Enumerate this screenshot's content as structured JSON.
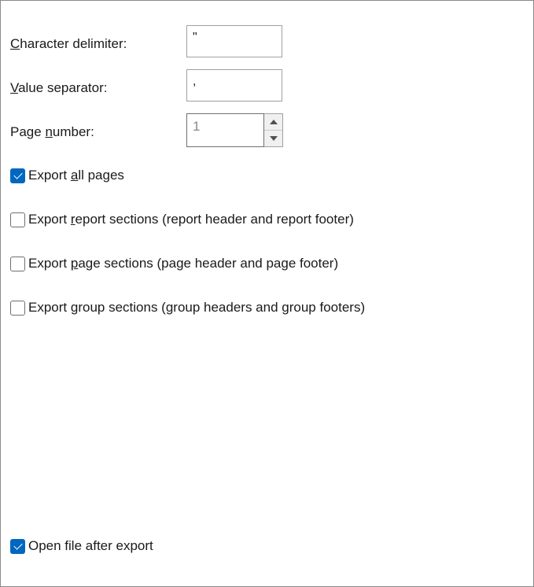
{
  "fields": {
    "character_delimiter": {
      "label_prefix": "",
      "label_key": "C",
      "label_rest": "haracter delimiter:",
      "value": "\""
    },
    "value_separator": {
      "label_prefix": "",
      "label_key": "V",
      "label_rest": "alue separator:",
      "value": ","
    },
    "page_number": {
      "label_prefix": "Page ",
      "label_key": "n",
      "label_rest": "umber:",
      "value": "1"
    }
  },
  "options": {
    "export_all_pages": {
      "prefix": "Export ",
      "key": "a",
      "rest": "ll pages",
      "checked": true
    },
    "export_report_sections": {
      "prefix": "Export ",
      "key": "r",
      "rest": "eport sections (report header and report footer)",
      "checked": false
    },
    "export_page_sections": {
      "prefix": "Export ",
      "key": "p",
      "rest": "age sections (page header and page footer)",
      "checked": false
    },
    "export_group_sections": {
      "prefix": "Export ",
      "key": "g",
      "rest": "roup sections (group headers and group footers)",
      "checked": false
    },
    "open_file_after_export": {
      "prefix": "",
      "key": "",
      "rest": "Open file after export",
      "checked": true
    }
  },
  "icons": {
    "spin_up": "triangle-up-icon",
    "spin_down": "triangle-down-icon",
    "check": "checkmark-icon"
  },
  "colors": {
    "accent": "#0067c0",
    "border": "#a0a0a0",
    "disabled_text": "#8a8a8a"
  }
}
